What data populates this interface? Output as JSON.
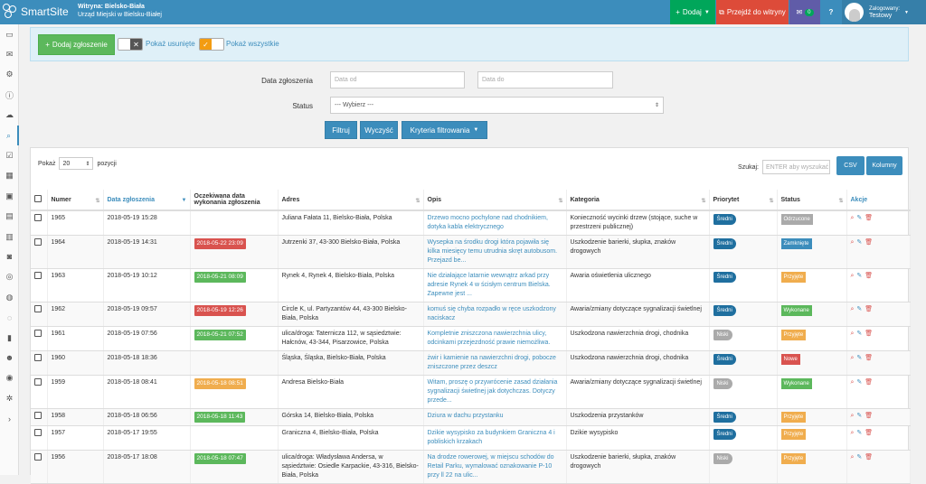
{
  "app": {
    "name": "SmartSite",
    "site_line1": "Witryna: Bielsko-Biała",
    "site_line2": "Urząd Miejski w Bielsku-Białej"
  },
  "topbar": {
    "add_label": "Dodaj",
    "goto_label": "Przejdź do witryny",
    "mail_count": "0",
    "help_label": "?",
    "logged_label": "Zalogowany:",
    "user_name": "Testowy"
  },
  "actionbar": {
    "add_label": "Dodaj zgłoszenie",
    "toggle1_off": "✕",
    "toggle1_label": "Pokaż usunięte",
    "toggle2_on": "✓",
    "toggle2_label": "Pokaż wszystkie"
  },
  "filters": {
    "date_label": "Data zgłoszenia",
    "date_from_ph": "Data od",
    "date_to_ph": "Data do",
    "status_label": "Status",
    "status_value": "--- Wybierz ---",
    "filter_btn": "Filtruj",
    "clear_btn": "Wyczyść",
    "criteria_btn": "Kryteria filtrowania"
  },
  "table_controls": {
    "show_label": "Pokaż",
    "page_size": "20",
    "items_label": "pozycji",
    "search_label": "Szukaj:",
    "search_ph": "ENTER aby wyszukać",
    "csv_btn": "CSV",
    "columns_btn": "Kolumny"
  },
  "columns": [
    "Numer",
    "Data zgłoszenia",
    "Oczekiwana data wykonania zgłoszenia",
    "Adres",
    "Opis",
    "Kategoria",
    "Priorytet",
    "Status",
    "Akcje"
  ],
  "colors": {
    "accent": "#3c8dbc",
    "green": "#5cb85c",
    "red": "#d9534f",
    "orange": "#f0ad4e",
    "gray": "#aaaaaa",
    "darkblue": "#1f6f9f"
  },
  "rows": [
    {
      "num": "1965",
      "date": "2018-05-19 15:28",
      "due": "",
      "due_color": "",
      "addr": "Juliana Fałata 11, Bielsko-Biała, Polska",
      "desc": "Drzewo mocno pochylone nad chodnikiem, dotyka kabla elektrycznego",
      "cat": "Konieczność wycinki drzew (stojące, suche w przestrzeni publicznej)",
      "prio": "Średni",
      "prio_color": "#1f6f9f",
      "status": "Odrzucone",
      "status_color": "#aaaaaa"
    },
    {
      "num": "1964",
      "date": "2018-05-19 14:31",
      "due": "2018-05-22 23:09",
      "due_color": "#d9534f",
      "addr": "Jutrzenki 37, 43-300 Bielsko-Biała, Polska",
      "desc": "Wysepka na środku drogi która pojawiła się kilka miesięcy temu utrudnia skręt autobusom. Przejazd be...",
      "cat": "Uszkodzenie barierki, słupka, znaków drogowych",
      "prio": "Średni",
      "prio_color": "#1f6f9f",
      "status": "Zamknięte",
      "status_color": "#3c8dbc"
    },
    {
      "num": "1963",
      "date": "2018-05-19 10:12",
      "due": "2018-05-21 08:09",
      "due_color": "#5cb85c",
      "addr": "Rynek 4, Rynek 4, Bielsko-Biała, Polska",
      "desc": "Nie działające latarnie wewnątrz arkad przy adresie Rynek 4 w ścisłym centrum Bielska. Zapewne jest ...",
      "cat": "Awaria oświetlenia ulicznego",
      "prio": "Średni",
      "prio_color": "#1f6f9f",
      "status": "Przyjęte",
      "status_color": "#f0ad4e"
    },
    {
      "num": "1962",
      "date": "2018-05-19 09:57",
      "due": "2018-05-19 12:26",
      "due_color": "#d9534f",
      "addr": "Circle K, ul. Partyzantów 44, 43-300 Bielsko-Biała, Polska",
      "desc": "komuś się chyba rozpadło w ręce uszkodzony naciskacz",
      "cat": "Awaria/zmiany dotyczące sygnalizacji świetlnej",
      "prio": "Średni",
      "prio_color": "#1f6f9f",
      "status": "Wykonane",
      "status_color": "#5cb85c"
    },
    {
      "num": "1961",
      "date": "2018-05-19 07:56",
      "due": "2018-05-21 07:52",
      "due_color": "#5cb85c",
      "addr": "ulica/droga: Taternicza 112, w sąsiedztwie: Hałcnów, 43-344, Pisarzowice, Polska",
      "desc": "Kompletnie zniszczona nawierzchnia ulicy, odcinkami przejezdność prawie niemożliwa.",
      "cat": "Uszkodzona nawierzchnia drogi, chodnika",
      "prio": "Niski",
      "prio_color": "#aaaaaa",
      "status": "Przyjęte",
      "status_color": "#f0ad4e"
    },
    {
      "num": "1960",
      "date": "2018-05-18 18:36",
      "due": "",
      "due_color": "",
      "addr": "Śląska, Śląska, Bielsko-Biała, Polska",
      "desc": "żwir i kamienie na nawierzchni drogi, pobocze zniszczone przez deszcz",
      "cat": "Uszkodzona nawierzchnia drogi, chodnika",
      "prio": "Średni",
      "prio_color": "#1f6f9f",
      "status": "Nowe",
      "status_color": "#d9534f"
    },
    {
      "num": "1959",
      "date": "2018-05-18 08:41",
      "due": "2018-05-18 08:51",
      "due_color": "#f0ad4e",
      "addr": "Andresa Bielsko-Biała",
      "desc": "Witam, proszę o przywrócenie zasad działania sygnalizacji świetlnej jak dotychczas. Dotyczy przede...",
      "cat": "Awaria/zmiany dotyczące sygnalizacji świetlnej",
      "prio": "Niski",
      "prio_color": "#aaaaaa",
      "status": "Wykonane",
      "status_color": "#5cb85c"
    },
    {
      "num": "1958",
      "date": "2018-05-18 06:56",
      "due": "2018-05-18 11:43",
      "due_color": "#5cb85c",
      "addr": "Górska 14, Bielsko-Biała, Polska",
      "desc": "Dziura w dachu przystanku",
      "cat": "Uszkodzenia przystanków",
      "prio": "Średni",
      "prio_color": "#1f6f9f",
      "status": "Przyjęte",
      "status_color": "#f0ad4e"
    },
    {
      "num": "1957",
      "date": "2018-05-17 19:55",
      "due": "",
      "due_color": "",
      "addr": "Graniczna 4, Bielsko-Biała, Polska",
      "desc": "Dzikie wysypisko za budynkiem Graniczna 4 i pobliskich krzakach",
      "cat": "Dzikie wysypisko",
      "prio": "Średni",
      "prio_color": "#1f6f9f",
      "status": "Przyjęte",
      "status_color": "#f0ad4e"
    },
    {
      "num": "1956",
      "date": "2018-05-17 18:08",
      "due": "2018-05-18 07:47",
      "due_color": "#5cb85c",
      "addr": "ulica/droga: Władysława Andersa, w sąsiedztwie: Osiedle Karpackie, 43-316, Bielsko-Biała, Polska",
      "desc": "Na drodze rowerowej, w miejscu schodów do Retail Parku, wymalować oznakowanie P-10 przy ll 22 na ulic...",
      "cat": "Uszkodzenie barierki, słupka, znaków drogowych",
      "prio": "Niski",
      "prio_color": "#aaaaaa",
      "status": "Przyjęte",
      "status_color": "#f0ad4e"
    }
  ]
}
